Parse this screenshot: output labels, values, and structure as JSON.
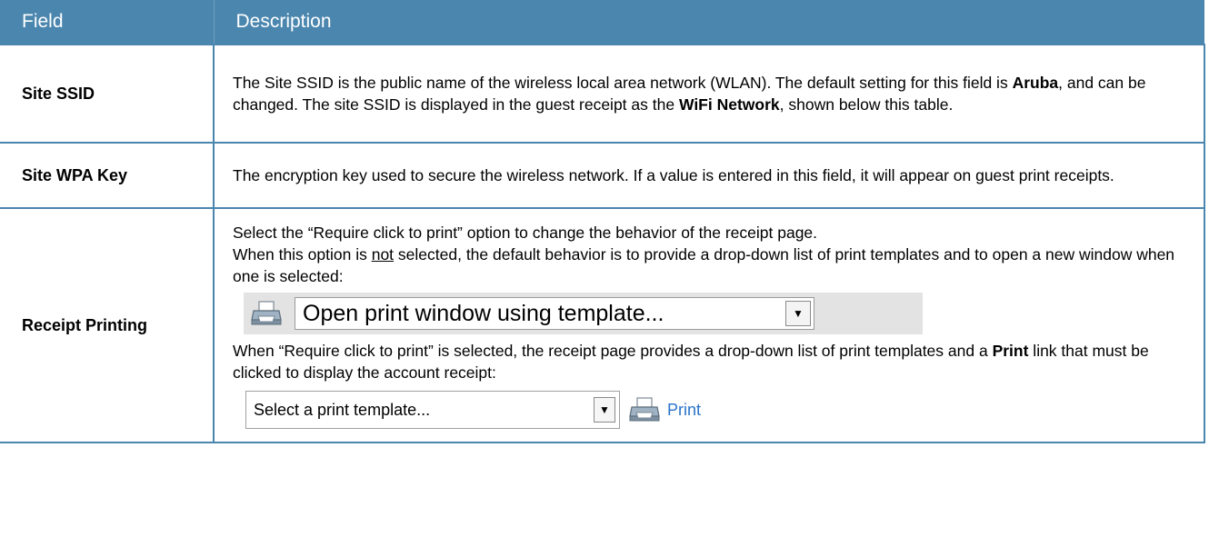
{
  "header": {
    "field": "Field",
    "description": "Description"
  },
  "rows": [
    {
      "field": "Site SSID",
      "desc": {
        "t1": "The Site SSID is the public name of the wireless local area network (WLAN). The default setting for this field is ",
        "b1": "Aruba",
        "t2": ", and can be changed. The site SSID is displayed in the guest receipt as the ",
        "b2": "WiFi Network",
        "t3": ", shown below this table."
      }
    },
    {
      "field": "Site WPA Key",
      "desc": {
        "t1": "The encryption key used to secure the wireless network. If a value is entered in this field, it will appear on guest print receipts."
      }
    },
    {
      "field": "Receipt Printing",
      "desc": {
        "p1": "Select the “Require click to print” option to change the behavior of the receipt page.",
        "p2a": "When this option is ",
        "p2u": "not",
        "p2b": " selected, the default behavior is to provide a drop-down list of print templates and to open a new window when one is selected:",
        "select1": "Open print window using template...",
        "p3a": "When “Require click to print” is selected, the receipt page provides a drop-down list of print templates and a ",
        "p3b": "Print",
        "p3c": " link that must be clicked to display the account receipt:",
        "select2": "Select a print template...",
        "print_link": "Print"
      }
    }
  ],
  "icons": {
    "printer": "printer-icon",
    "dropdown": "chevron-down-icon"
  },
  "colors": {
    "header_bg": "#4a86ae",
    "border": "#4a86ae",
    "link": "#2a73c9"
  }
}
